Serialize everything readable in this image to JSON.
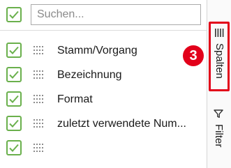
{
  "search": {
    "placeholder": "Suchen...",
    "value": ""
  },
  "columns": [
    {
      "label": "Stamm/Vorgang",
      "checked": true
    },
    {
      "label": "Bezeichnung",
      "checked": true
    },
    {
      "label": "Format",
      "checked": true
    },
    {
      "label": "zuletzt verwendete Num...",
      "checked": true
    },
    {
      "label": "",
      "checked": true
    }
  ],
  "sidebar": {
    "tabs": [
      {
        "label": "Spalten",
        "icon": "columns-icon",
        "active": true
      },
      {
        "label": "Filter",
        "icon": "funnel-icon",
        "active": false
      }
    ]
  },
  "annotation": {
    "number": "3"
  },
  "colors": {
    "checkbox": "#6ab04c",
    "annotation": "#e2001a"
  }
}
